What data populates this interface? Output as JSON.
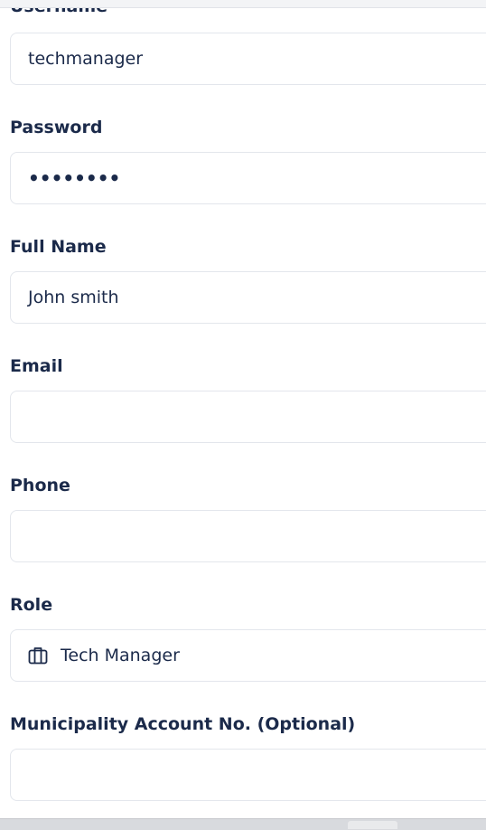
{
  "form": {
    "username": {
      "label": "Username",
      "value": "techmanager"
    },
    "password": {
      "label": "Password",
      "value": "••••••••"
    },
    "full_name": {
      "label": "Full Name",
      "value": "John smith"
    },
    "email": {
      "label": "Email",
      "value": ""
    },
    "phone": {
      "label": "Phone",
      "value": ""
    },
    "role": {
      "label": "Role",
      "value": "Tech Manager",
      "icon": "briefcase-icon"
    },
    "municipality_account": {
      "label": "Municipality Account No. (Optional)",
      "value": ""
    }
  }
}
